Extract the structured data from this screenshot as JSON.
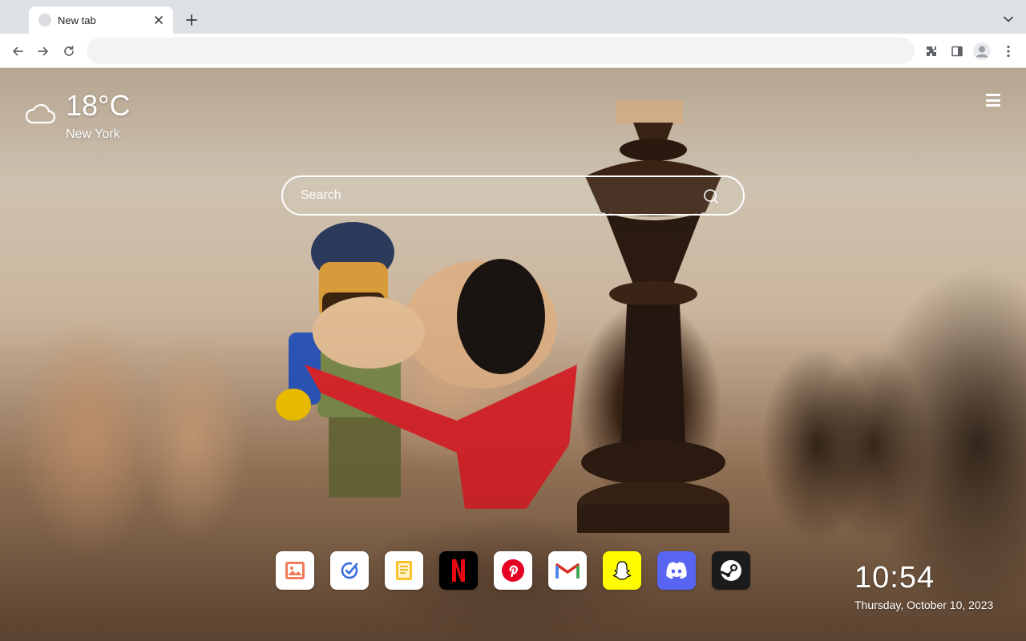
{
  "browser": {
    "tab": {
      "title": "New tab"
    },
    "omnibox": {
      "value": "",
      "placeholder": ""
    },
    "icons": [
      "back-icon",
      "forward-icon",
      "reload-icon",
      "extensions-icon",
      "side-panel-icon",
      "profile-icon",
      "more-icon"
    ]
  },
  "weather": {
    "temperature": "18°C",
    "city": "New York",
    "icon": "cloud-icon"
  },
  "search": {
    "placeholder": "Search"
  },
  "apps": [
    {
      "name": "photos",
      "color": "#ffffff"
    },
    {
      "name": "tasks",
      "color": "#ffffff"
    },
    {
      "name": "notes",
      "color": "#ffffff"
    },
    {
      "name": "netflix",
      "color": "#000000"
    },
    {
      "name": "pinterest",
      "color": "#ffffff"
    },
    {
      "name": "gmail",
      "color": "#ffffff"
    },
    {
      "name": "snapchat",
      "color": "#fffc00"
    },
    {
      "name": "discord",
      "color": "#5865f2"
    },
    {
      "name": "steam",
      "color": "#1b1b1b"
    }
  ],
  "clock": {
    "time": "10:54",
    "date": "Thursday, October 10, 2023"
  }
}
